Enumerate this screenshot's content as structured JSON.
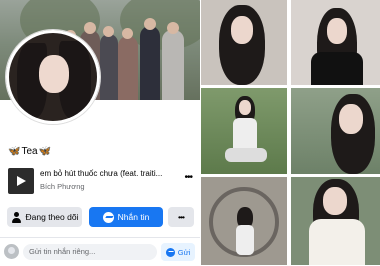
{
  "profile": {
    "name": "Tea",
    "name_prefix_emoji": "🦋",
    "name_suffix_emoji": "🦋",
    "music": {
      "song": "em bỏ hút thuốc chưa (feat. traiti...",
      "artist": "Bích Phương"
    },
    "buttons": {
      "follow": "Đang theo dõi",
      "message": "Nhắn tin",
      "more": "•••"
    },
    "compose": {
      "placeholder": "Gửi tin nhắn riêng...",
      "send": "Gửi"
    }
  },
  "photos": [
    "photo-1",
    "photo-2",
    "photo-3",
    "photo-4",
    "photo-5",
    "photo-6"
  ],
  "colors": {
    "accent": "#1877f2",
    "button_gray": "#e4e6eb",
    "text_secondary": "#65676b"
  },
  "icons": [
    "music-album-icon",
    "more-dots-icon",
    "person-check-icon",
    "messenger-icon",
    "user-avatar-icon"
  ]
}
